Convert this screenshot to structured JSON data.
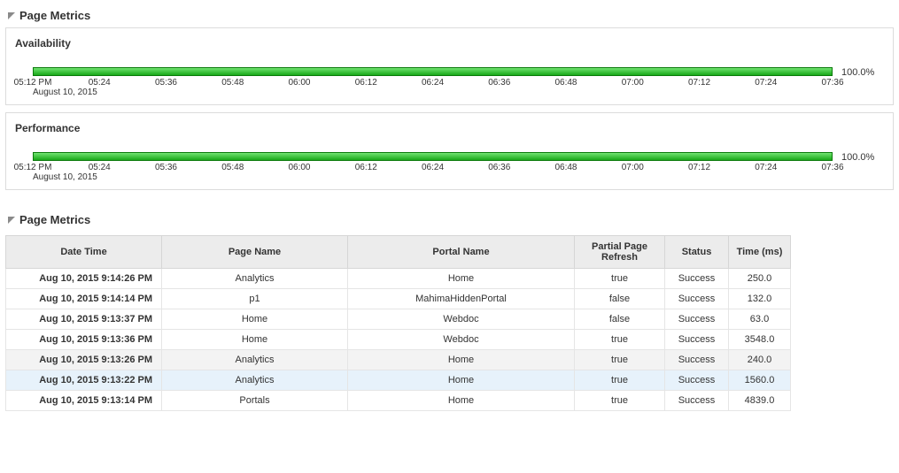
{
  "section1": {
    "title": "Page Metrics"
  },
  "availability": {
    "title": "Availability",
    "percent": "100.0%",
    "date_label": "August 10, 2015",
    "ticks": [
      "05:12 PM",
      "05:24",
      "05:36",
      "05:48",
      "06:00",
      "06:12",
      "06:24",
      "06:36",
      "06:48",
      "07:00",
      "07:12",
      "07:24",
      "07:36"
    ]
  },
  "performance": {
    "title": "Performance",
    "percent": "100.0%",
    "date_label": "August 10, 2015",
    "ticks": [
      "05:12 PM",
      "05:24",
      "05:36",
      "05:48",
      "06:00",
      "06:12",
      "06:24",
      "06:36",
      "06:48",
      "07:00",
      "07:12",
      "07:24",
      "07:36"
    ]
  },
  "section2": {
    "title": "Page Metrics"
  },
  "table": {
    "headers": {
      "date_time": "Date Time",
      "page_name": "Page Name",
      "portal_name": "Portal Name",
      "ppr": "Partial Page Refresh",
      "status": "Status",
      "time_ms": "Time (ms)"
    },
    "rows": [
      {
        "dt": "Aug 10, 2015 9:14:26 PM",
        "pn": "Analytics",
        "por": "Home",
        "ppr": "true",
        "st": "Success",
        "tm": "250.0"
      },
      {
        "dt": "Aug 10, 2015 9:14:14 PM",
        "pn": "p1",
        "por": "MahimaHiddenPortal",
        "ppr": "false",
        "st": "Success",
        "tm": "132.0"
      },
      {
        "dt": "Aug 10, 2015 9:13:37 PM",
        "pn": "Home",
        "por": "Webdoc",
        "ppr": "false",
        "st": "Success",
        "tm": "63.0"
      },
      {
        "dt": "Aug 10, 2015 9:13:36 PM",
        "pn": "Home",
        "por": "Webdoc",
        "ppr": "true",
        "st": "Success",
        "tm": "3548.0"
      },
      {
        "dt": "Aug 10, 2015 9:13:26 PM",
        "pn": "Analytics",
        "por": "Home",
        "ppr": "true",
        "st": "Success",
        "tm": "240.0",
        "_shade": true
      },
      {
        "dt": "Aug 10, 2015 9:13:22 PM",
        "pn": "Analytics",
        "por": "Home",
        "ppr": "true",
        "st": "Success",
        "tm": "1560.0",
        "_sel": true
      },
      {
        "dt": "Aug 10, 2015 9:13:14 PM",
        "pn": "Portals",
        "por": "Home",
        "ppr": "true",
        "st": "Success",
        "tm": "4839.0"
      }
    ]
  },
  "chart_data": [
    {
      "type": "bar",
      "title": "Availability",
      "series": [
        {
          "name": "Availability",
          "values": [
            100.0
          ]
        }
      ],
      "x_ticks": [
        "05:12 PM",
        "05:24",
        "05:36",
        "05:48",
        "06:00",
        "06:12",
        "06:24",
        "06:36",
        "06:48",
        "07:00",
        "07:12",
        "07:24",
        "07:36"
      ],
      "x_date": "August 10, 2015",
      "y_unit": "%",
      "ylim": [
        0,
        100
      ],
      "value_label": "100.0%"
    },
    {
      "type": "bar",
      "title": "Performance",
      "series": [
        {
          "name": "Performance",
          "values": [
            100.0
          ]
        }
      ],
      "x_ticks": [
        "05:12 PM",
        "05:24",
        "05:36",
        "05:48",
        "06:00",
        "06:12",
        "06:24",
        "06:36",
        "06:48",
        "07:00",
        "07:12",
        "07:24",
        "07:36"
      ],
      "x_date": "August 10, 2015",
      "y_unit": "%",
      "ylim": [
        0,
        100
      ],
      "value_label": "100.0%"
    }
  ]
}
